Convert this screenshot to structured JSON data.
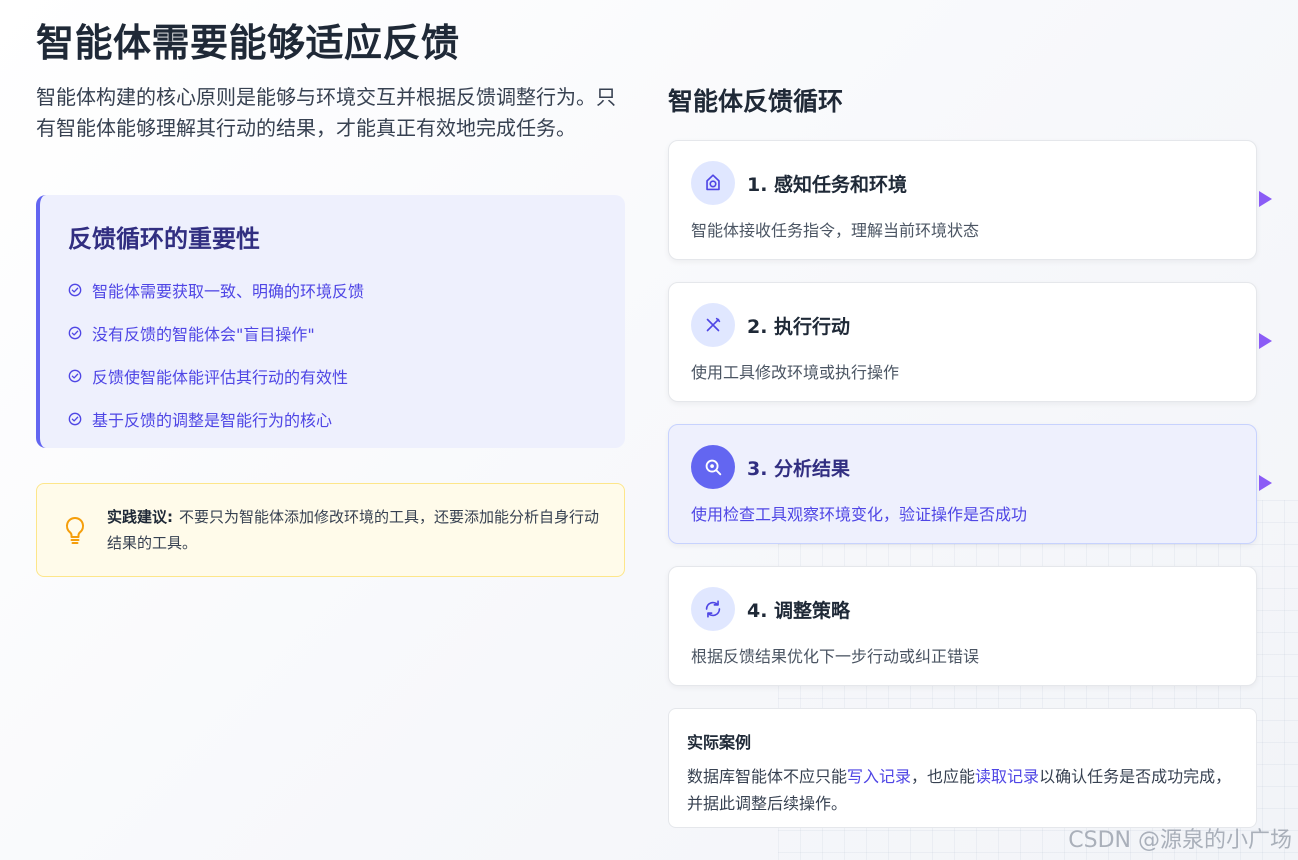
{
  "page": {
    "title": "智能体需要能够适应反馈",
    "intro": "智能体构建的核心原则是能够与环境交互并根据反馈调整行为。只有智能体能够理解其行动的结果，才能真正有效地完成任务。"
  },
  "importance": {
    "title": "反馈循环的重要性",
    "items": [
      {
        "text": "智能体需要获取一致、明确的环境反馈",
        "icon": "check-circle-icon"
      },
      {
        "text": "没有反馈的智能体会\"盲目操作\"",
        "icon": "check-circle-icon"
      },
      {
        "text": "反馈使智能体能评估其行动的有效性",
        "icon": "check-circle-icon"
      },
      {
        "text": "基于反馈的调整是智能行为的核心",
        "icon": "check-circle-icon"
      }
    ]
  },
  "tip": {
    "label": "实践建议:",
    "text": "不要只为智能体添加修改环境的工具，还要添加能分析自身行动结果的工具。",
    "icon": "lightbulb-icon"
  },
  "loop": {
    "title": "智能体反馈循环",
    "steps": [
      {
        "title": "1. 感知任务和环境",
        "desc": "智能体接收任务指令，理解当前环境状态",
        "icon": "camera-icon",
        "active": false
      },
      {
        "title": "2. 执行行动",
        "desc": "使用工具修改环境或执行操作",
        "icon": "tools-icon",
        "active": false
      },
      {
        "title": "3. 分析结果",
        "desc": "使用检查工具观察环境变化，验证操作是否成功",
        "icon": "search-icon",
        "active": true
      },
      {
        "title": "4. 调整策略",
        "desc": "根据反馈结果优化下一步行动或纠正错误",
        "icon": "refresh-icon",
        "active": false
      }
    ]
  },
  "case": {
    "title": "实际案例",
    "text_1": "数据库智能体不应只能",
    "link_1": "写入记录",
    "text_2": "，也应能",
    "link_2": "读取记录",
    "text_3": "以确认任务是否成功完成，并据此调整后续操作。"
  },
  "watermark": "CSDN @源泉的小广场",
  "colors": {
    "accent": "#6366f1",
    "accent_dark": "#312e81",
    "arrow": "#8b5cf6",
    "tip_bg": "#fffbea",
    "tip_icon": "#f59e0b"
  }
}
